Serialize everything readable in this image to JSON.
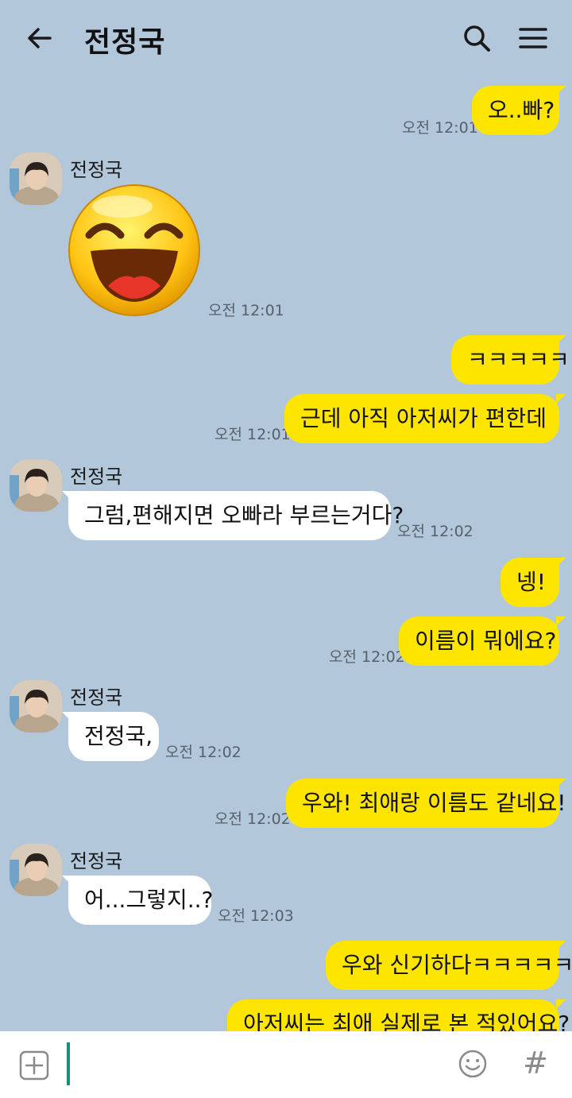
{
  "header": {
    "title": "전정국"
  },
  "contact": {
    "name": "전정국"
  },
  "messages": [
    {
      "text": "오..빠?",
      "time": "오전 12:01"
    },
    {
      "emoticon": "laughing-face",
      "time": "오전 12:01"
    },
    {
      "text": "ㅋㅋㅋㅋㅋ"
    },
    {
      "text": "근데 아직 아저씨가 편한데",
      "time": "오전 12:01"
    },
    {
      "text": "그럼,편해지면 오빠라 부르는거다?",
      "time": "오전 12:02"
    },
    {
      "text": "넹!"
    },
    {
      "text": "이름이 뭐에요?",
      "time": "오전 12:02"
    },
    {
      "text": "전정국,",
      "time": "오전 12:02"
    },
    {
      "text": "우와! 최애랑 이름도 같네요!",
      "time": "오전 12:02"
    },
    {
      "text": "어...그렇지..?",
      "time": "오전 12:03"
    },
    {
      "text": "우와 신기하다ㅋㅋㅋㅋㅋ"
    },
    {
      "text": "아저씨는 최애 실제로 본 적있어요?"
    }
  ],
  "input": {
    "hash_label": "#"
  },
  "icons": {
    "back": "arrow-left-icon",
    "search": "search-icon",
    "menu": "hamburger-menu-icon",
    "add": "plus-box-icon",
    "emoji": "smiley-icon"
  },
  "colors": {
    "background": "#b2c7da",
    "my_bubble": "#fee500",
    "other_bubble": "#ffffff"
  }
}
